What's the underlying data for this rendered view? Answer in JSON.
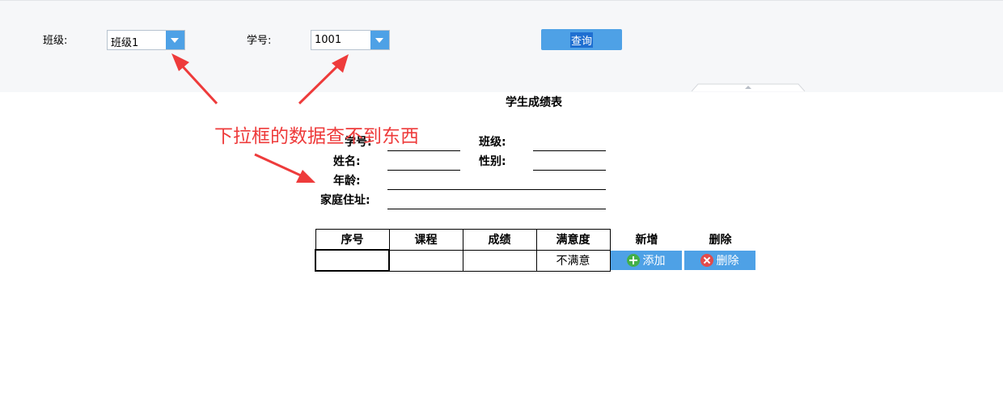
{
  "params": {
    "class_label": "班级:",
    "class_value": "班级1",
    "student_no_label": "学号:",
    "student_no_value": "1001",
    "query_button": "查询"
  },
  "report": {
    "title": "学生成绩表",
    "fields": {
      "student_no": "学号:",
      "class": "班级:",
      "name": "姓名:",
      "gender": "性别:",
      "age": "年龄:",
      "address": "家庭住址:"
    },
    "table": {
      "headers": [
        "序号",
        "课程",
        "成绩",
        "满意度"
      ],
      "action_headers": [
        "新增",
        "删除"
      ],
      "row": [
        "",
        "",
        "",
        "不满意"
      ],
      "add_button": "添加",
      "delete_button": "删除"
    }
  },
  "annotation": {
    "text": "下拉框的数据查不到东西",
    "color": "#ee3b3b"
  },
  "colors": {
    "accent": "#4ea1e6",
    "param_bg": "#f6f7f9"
  },
  "icons": {
    "dropdown": "chevron-down-icon",
    "add": "plus-circle-icon",
    "delete": "x-circle-icon"
  }
}
